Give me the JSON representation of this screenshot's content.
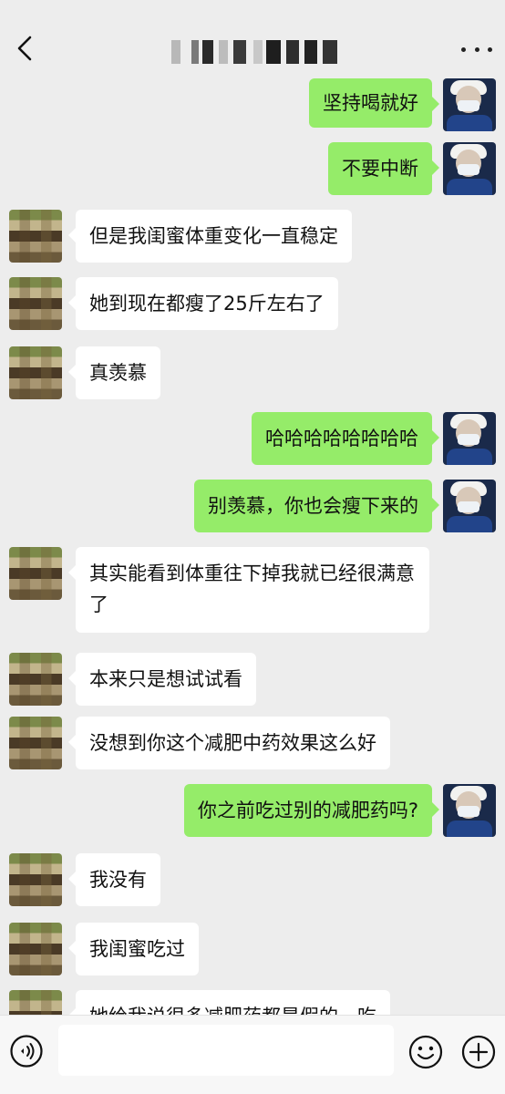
{
  "header": {
    "title": "",
    "back_icon": "chevron-left-icon",
    "more_icon": "more-dots-icon"
  },
  "messages": [
    {
      "from": "me",
      "text": "坚持喝就好"
    },
    {
      "from": "me",
      "text": "不要中断"
    },
    {
      "from": "other",
      "text": "但是我闺蜜体重变化一直稳定"
    },
    {
      "from": "other",
      "text": "她到现在都瘦了25斤左右了"
    },
    {
      "from": "other",
      "text": "真羡慕"
    },
    {
      "from": "me",
      "text": "哈哈哈哈哈哈哈哈"
    },
    {
      "from": "me",
      "text": "别羡慕，你也会瘦下来的"
    },
    {
      "from": "other",
      "text": "其实能看到体重往下掉我就已经很满意了"
    },
    {
      "from": "other",
      "text": "本来只是想试试看"
    },
    {
      "from": "other",
      "text": "没想到你这个减肥中药效果这么好"
    },
    {
      "from": "me",
      "text": "你之前吃过别的减肥药吗?"
    },
    {
      "from": "other",
      "text": "我没有"
    },
    {
      "from": "other",
      "text": "我闺蜜吃过"
    },
    {
      "from": "other",
      "text": "她给我说很多减肥药都是假的，吃"
    }
  ],
  "input_bar": {
    "voice_icon": "voice-icon",
    "input_value": "",
    "emoji_icon": "emoji-icon",
    "plus_icon": "plus-icon"
  },
  "colors": {
    "background": "#ededed",
    "my_bubble": "#95ec69",
    "other_bubble": "#ffffff"
  }
}
